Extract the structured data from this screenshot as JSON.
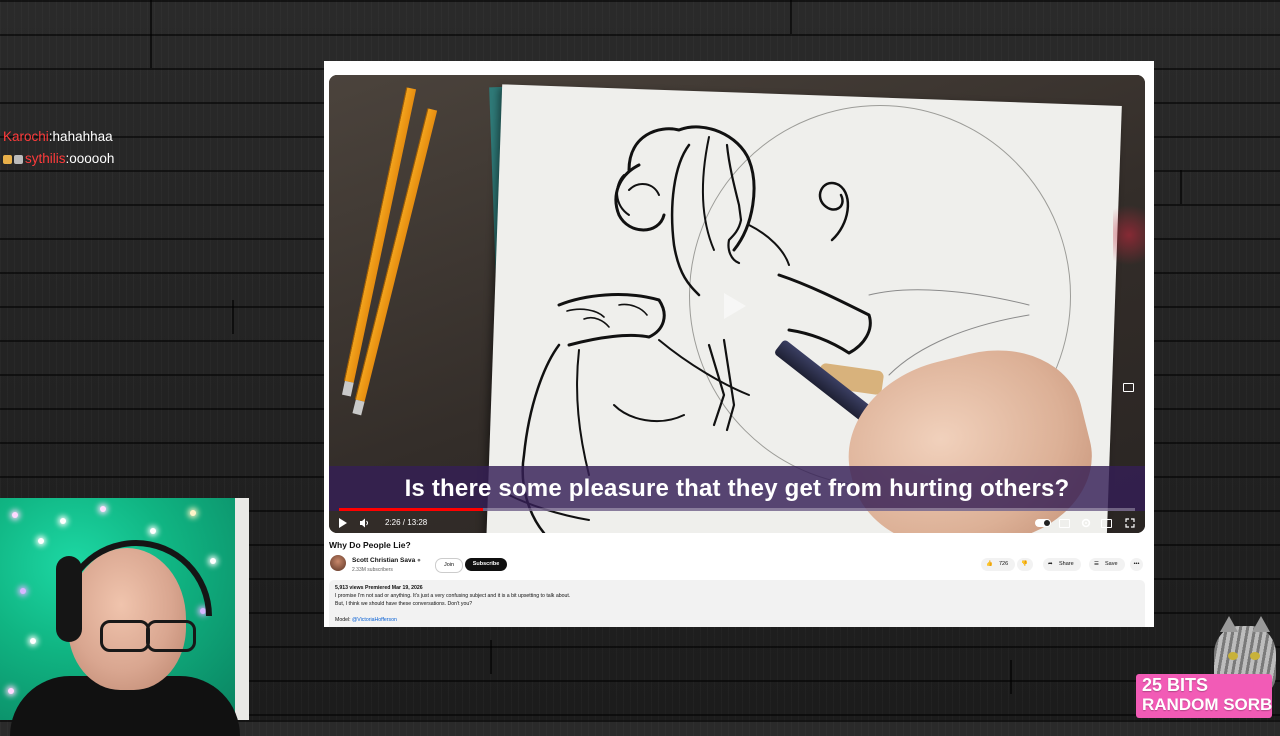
{
  "chat": {
    "messages": [
      {
        "user": "Karochi",
        "sep": ":",
        "text": " hahahhaa",
        "badges": []
      },
      {
        "user": "sythilis",
        "sep": ":",
        "text": " oooooh",
        "badges": [
          "#e8b04a",
          "#bbbbbb"
        ]
      }
    ]
  },
  "video": {
    "caption": "Is there some pleasure that they get from hurting others?",
    "time": "2:26 / 13:28",
    "progress_fraction": 0.181,
    "title": "Why Do People Lie?",
    "channel_name": "Scott Christian Sava",
    "subscribers": "2.33M subscribers",
    "join_label": "Join",
    "subscribe_label": "Subscribe",
    "likes": "726",
    "share_label": "Share",
    "save_label": "Save",
    "more_label": "•••",
    "description": {
      "stats": "5,913 views  Premiered Mar 19, 2026",
      "line1": "I promise I'm not sad or anything. It's just a very confusing subject and it is a bit upsetting to talk about.",
      "line2": "But, I think we should have these conversations. Don't you?",
      "model_label": "Model: ",
      "model_link": "@VictoriaHofferson"
    }
  },
  "alert": {
    "bits": "25 BITS",
    "user": "RANDOM SORB"
  },
  "colors": {
    "chat_username": "#ff3b3b",
    "progress": "#ff0000",
    "caption_bg": "#341e56",
    "alert_bg": "#f25bb6"
  }
}
